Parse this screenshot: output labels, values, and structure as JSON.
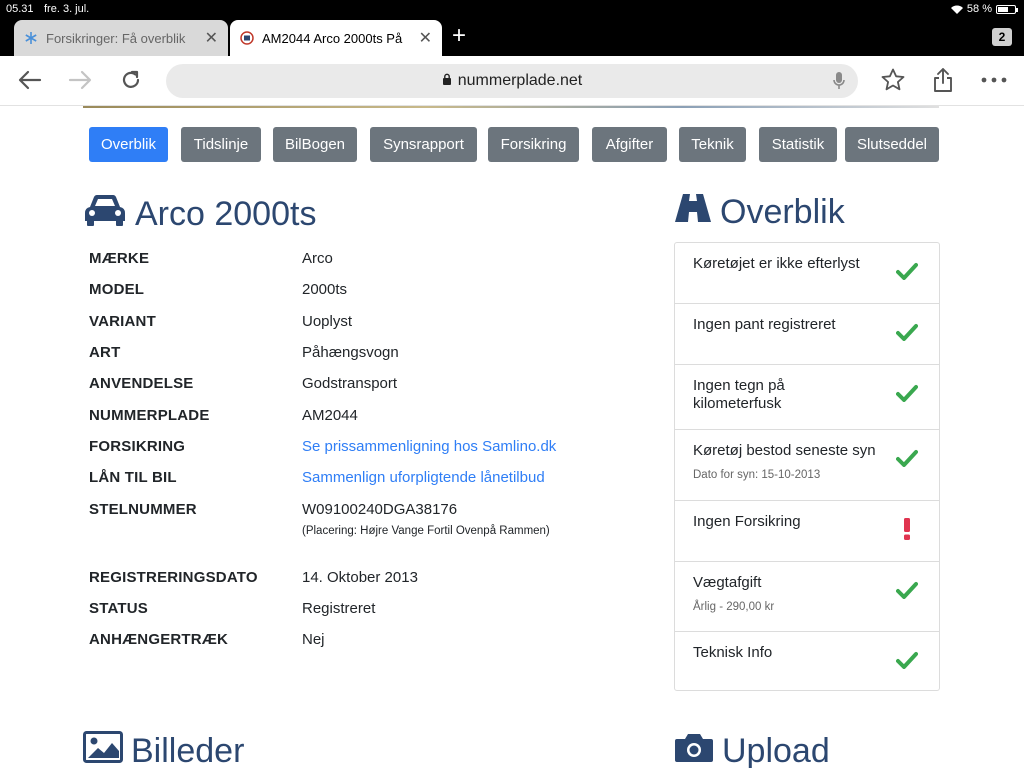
{
  "status_bar": {
    "time": "05.31",
    "date": "fre. 3. jul.",
    "battery": "58 %"
  },
  "tabs": [
    {
      "label": "Forsikringer: Få overblik",
      "active": false
    },
    {
      "label": "AM2044 Arco 2000ts På",
      "active": true
    }
  ],
  "tab_count": "2",
  "new_tab_label": "+",
  "url": "nummerplade.net",
  "nav": [
    {
      "label": "Overblik",
      "active": true
    },
    {
      "label": "Tidslinje",
      "active": false
    },
    {
      "label": "BilBogen",
      "active": false
    },
    {
      "label": "Synsrapport",
      "active": false
    },
    {
      "label": "Forsikring",
      "active": false
    },
    {
      "label": "Afgifter",
      "active": false
    },
    {
      "label": "Teknik",
      "active": false
    },
    {
      "label": "Statistik",
      "active": false
    },
    {
      "label": "Slutseddel",
      "active": false
    }
  ],
  "vehicle_title": "Arco 2000ts",
  "overview_title": "Overblik",
  "specs": [
    {
      "key": "MÆRKE",
      "value": "Arco"
    },
    {
      "key": "MODEL",
      "value": "2000ts"
    },
    {
      "key": "VARIANT",
      "value": "Uoplyst"
    },
    {
      "key": "ART",
      "value": "Påhængsvogn"
    },
    {
      "key": "ANVENDELSE",
      "value": "Godstransport"
    },
    {
      "key": "NUMMERPLADE",
      "value": "AM2044"
    },
    {
      "key": "FORSIKRING",
      "value": "Se prissammenligning hos Samlino.dk",
      "link": true
    },
    {
      "key": "LÅN TIL BIL",
      "value": "Sammenlign uforpligtende lånetilbud",
      "link": true
    },
    {
      "key": "STELNUMMER",
      "value": "W09100240DGA38176",
      "note": "(Placering: Højre Vange Fortil Ovenpå Rammen)"
    },
    {
      "key": "REGISTRERINGSDATO",
      "value": "14. Oktober 2013"
    },
    {
      "key": "STATUS",
      "value": "Registreret"
    },
    {
      "key": "ANHÆNGERTRÆK",
      "value": "Nej"
    }
  ],
  "overview": [
    {
      "label": "Køretøjet er ikke efterlyst",
      "status": "ok"
    },
    {
      "label": "Ingen pant registreret",
      "status": "ok"
    },
    {
      "label": "Ingen tegn på kilometerfusk",
      "status": "ok"
    },
    {
      "label": "Køretøj bestod seneste syn",
      "sub": "Dato for syn: 15-10-2013",
      "status": "ok"
    },
    {
      "label": "Ingen Forsikring",
      "status": "warning"
    },
    {
      "label": "Vægtafgift",
      "sub": "Årlig - 290,00 kr",
      "status": "ok"
    },
    {
      "label": "Teknisk Info",
      "status": "ok"
    }
  ],
  "images_title": "Billeder",
  "upload_title": "Upload",
  "colors": {
    "primary": "#2f7ef6",
    "secondary": "#6c757d",
    "heading": "#2c4770",
    "ok": "#3aa84f",
    "warning": "#e0344f"
  }
}
